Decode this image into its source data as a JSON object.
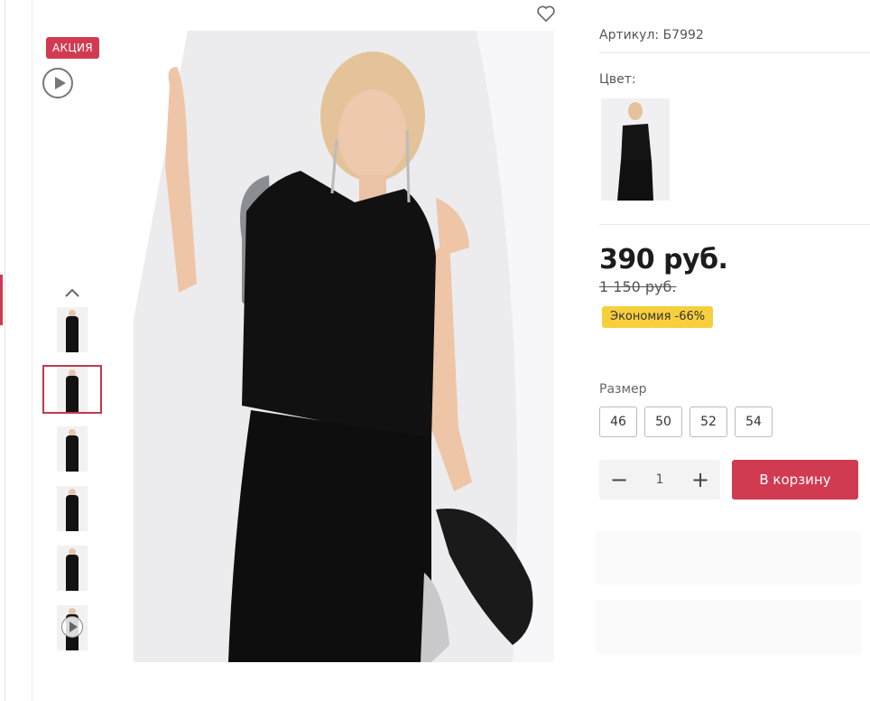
{
  "badges": {
    "sale": "АКЦИЯ"
  },
  "gallery": {
    "video_icon": "play-circle-icon",
    "up_icon": "chevron-up-icon",
    "favorite_icon": "heart-icon",
    "thumbnails": [
      {
        "kind": "photo",
        "active": false
      },
      {
        "kind": "photo",
        "active": true
      },
      {
        "kind": "photo",
        "active": false
      },
      {
        "kind": "photo",
        "active": false
      },
      {
        "kind": "photo",
        "active": false
      },
      {
        "kind": "video",
        "active": false
      }
    ]
  },
  "product": {
    "article": "Артикул: Б7992",
    "color_label": "Цвет:",
    "price": "390 руб.",
    "old_price": "1 150 руб.",
    "saving": "Экономия -66%",
    "size_label": "Размер",
    "sizes": [
      "46",
      "50",
      "52",
      "54"
    ],
    "quantity": "1",
    "qty_minus": "−",
    "qty_plus": "+",
    "add_to_cart": "В корзину"
  },
  "colors": {
    "accent": "#d13b52",
    "saving_bg": "#f7cf3c"
  }
}
